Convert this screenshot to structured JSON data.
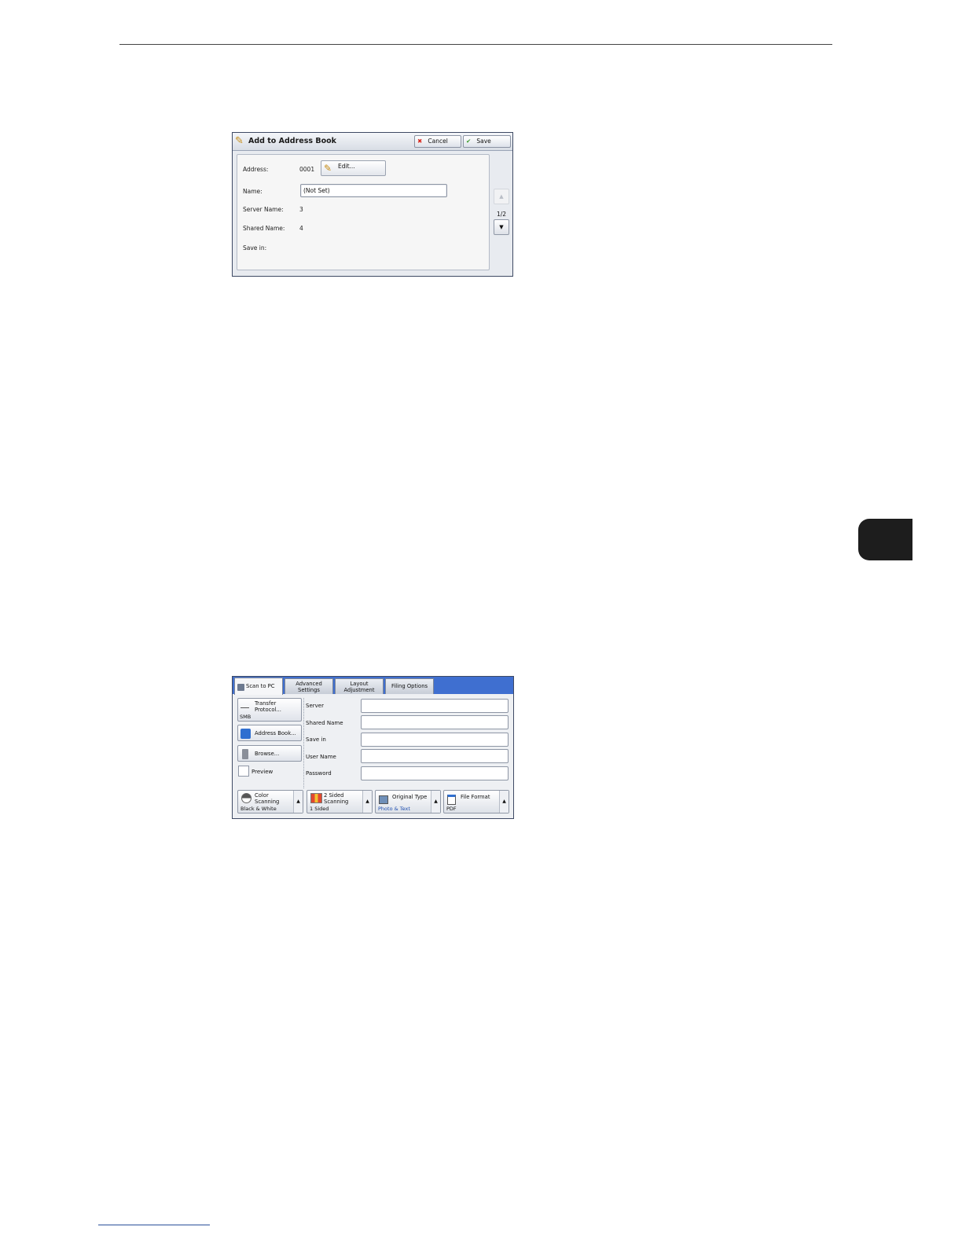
{
  "add_to_address_book": {
    "title": "Add to Address Book",
    "cancel_label": "Cancel",
    "save_label": "Save",
    "address_label": "Address:",
    "address_value": "0001",
    "edit_label": "Edit...",
    "name_label": "Name:",
    "name_value": "(Not Set)",
    "server_name_label": "Server Name:",
    "server_name_value": "3",
    "shared_name_label": "Shared Name:",
    "shared_name_value": "4",
    "save_in_label": "Save in:",
    "page_indicator": "1/2",
    "up_arrow": "▲",
    "down_arrow": "▼"
  },
  "scan_to_pc": {
    "tabs": [
      {
        "label": "Scan to PC",
        "active": true
      },
      {
        "label": "Advanced\nSettings",
        "active": false
      },
      {
        "label": "Layout\nAdjustment",
        "active": false
      },
      {
        "label": "Filing Options",
        "active": false
      }
    ],
    "transfer_protocol_label": "Transfer Protocol...",
    "transfer_protocol_value": "SMB",
    "address_book_label": "Address Book...",
    "browse_label": "Browse...",
    "preview_label": "Preview",
    "fields": {
      "server": "Server",
      "shared_name": "Shared Name",
      "save_in": "Save in",
      "user_name": "User Name",
      "password": "Password"
    },
    "bottom": {
      "color_scanning_label": "Color Scanning",
      "color_scanning_value": "Black & White",
      "two_sided_label": "2 Sided Scanning",
      "two_sided_value": "1 Sided",
      "original_type_label": "Original Type",
      "original_type_value": "Photo & Text",
      "file_format_label": "File Format",
      "file_format_value": "PDF",
      "arrow": "▲"
    },
    "accent_color": "#3f6fd0"
  }
}
